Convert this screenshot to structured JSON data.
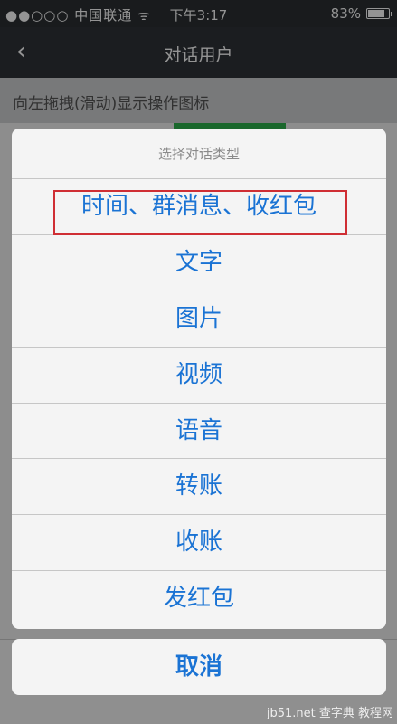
{
  "status_bar": {
    "carrier": "●●○○○ 中国联通 ᯤ",
    "time": "下午3:17",
    "battery_text": "83%",
    "battery_level": 0.83
  },
  "nav": {
    "back_glyph": "‹",
    "title": "对话用户"
  },
  "hint": "向左拖拽(滑动)显示操作图标",
  "sheet": {
    "title": "选择对话类型",
    "items": [
      "时间、群消息、收红包",
      "文字",
      "图片",
      "视频",
      "语音",
      "转账",
      "收账",
      "发红包"
    ],
    "cancel": "取消"
  },
  "watermark": "jb51.net 查字典 教程网"
}
